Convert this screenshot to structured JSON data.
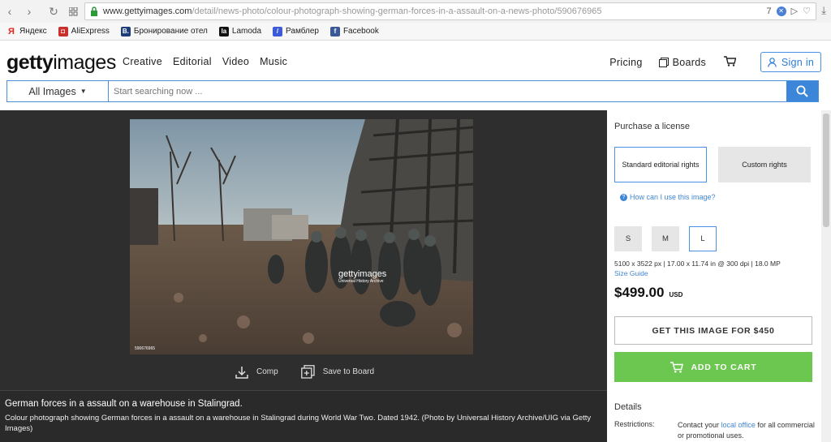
{
  "browser": {
    "url_host": "www.gettyimages.com",
    "url_path": "/detail/news-photo/colour-photograph-showing-german-forces-in-a-assault-on-a-news-photo/590676965",
    "tab_count": "7",
    "bookmarks": [
      {
        "label": "Яндекс",
        "icon": "yandex-icon",
        "color": "#e52620"
      },
      {
        "label": "AliExpress",
        "icon": "aliexpress-icon",
        "color": "#c9302c"
      },
      {
        "label": "Бронирование отел",
        "icon": "booking-icon",
        "color": "#1d3d7a"
      },
      {
        "label": "Lamoda",
        "icon": "lamoda-icon",
        "color": "#111111"
      },
      {
        "label": "Рамблер",
        "icon": "rambler-icon",
        "color": "#3d5bd9"
      },
      {
        "label": "Facebook",
        "icon": "facebook-icon",
        "color": "#3b5998"
      }
    ]
  },
  "header": {
    "logo_bold": "getty",
    "logo_light": "images",
    "nav": [
      "Creative",
      "Editorial",
      "Video",
      "Music"
    ],
    "pricing": "Pricing",
    "boards": "Boards",
    "signin": "Sign in"
  },
  "search": {
    "category": "All Images",
    "placeholder": "Start searching now ..."
  },
  "photo": {
    "watermark_title": "gettyimages",
    "watermark_sub": "Universal History Archive",
    "id_tag": "590676965",
    "comp_label": "Comp",
    "save_label": "Save to Board"
  },
  "caption": {
    "title": "German forces in a assault on a warehouse in Stalingrad.",
    "description": "Colour photograph showing German forces in a assault on a warehouse in Stalingrad during World War Two. Dated 1942. (Photo by Universal History Archive/UIG via Getty Images)"
  },
  "panel": {
    "purchase_title": "Purchase a license",
    "license_standard": "Standard editorial rights",
    "license_custom": "Custom rights",
    "how_link": "How can I use this image?",
    "sizes": [
      "S",
      "M",
      "L"
    ],
    "selected_size": "L",
    "dimensions": "5100 x 3522 px | 17.00 x 11.74 in @ 300 dpi | 18.0 MP",
    "size_guide": "Size Guide",
    "price": "$499.00",
    "currency": "USD",
    "get_button": "GET THIS IMAGE FOR $450",
    "cart_button": "ADD TO CART",
    "details_title": "Details",
    "restrictions_label": "Restrictions:",
    "restrictions_text_1": "Contact your ",
    "restrictions_link": "local office",
    "restrictions_text_2": " for all commercial or promotional uses."
  },
  "colors": {
    "accent_blue": "#3b86d8",
    "cart_green": "#6cc750",
    "dark_bg": "#2e2e2e"
  }
}
